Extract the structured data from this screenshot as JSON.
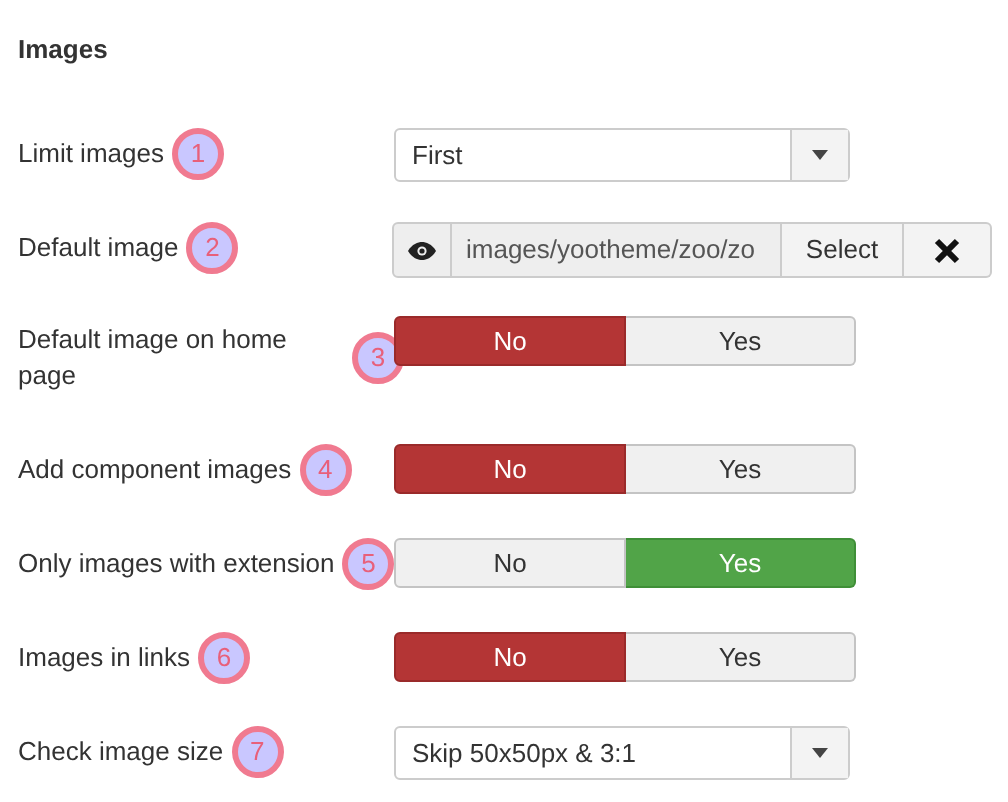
{
  "section_title": "Images",
  "rows": [
    {
      "kind": "select",
      "label": "Limit images",
      "badge": "1",
      "value": "First"
    },
    {
      "kind": "image",
      "label": "Default image",
      "badge": "2",
      "value": "images/yootheme/zoo/zo",
      "button": "Select"
    },
    {
      "kind": "toggle",
      "label": "Default image on home page",
      "badge": "3",
      "options": [
        {
          "label": "No",
          "selected": true
        },
        {
          "label": "Yes",
          "selected": false
        }
      ]
    },
    {
      "kind": "toggle",
      "label": "Add component images",
      "badge": "4",
      "options": [
        {
          "label": "No",
          "selected": true
        },
        {
          "label": "Yes",
          "selected": false
        }
      ]
    },
    {
      "kind": "toggle",
      "label": "Only images with extension",
      "badge": "5",
      "options": [
        {
          "label": "No",
          "selected": false
        },
        {
          "label": "Yes",
          "selected": true
        }
      ]
    },
    {
      "kind": "toggle",
      "label": "Images in links",
      "badge": "6",
      "options": [
        {
          "label": "No",
          "selected": true
        },
        {
          "label": "Yes",
          "selected": false
        }
      ]
    },
    {
      "kind": "select",
      "label": "Check image size",
      "badge": "7",
      "value": "Skip 50x50px & 3:1"
    }
  ]
}
